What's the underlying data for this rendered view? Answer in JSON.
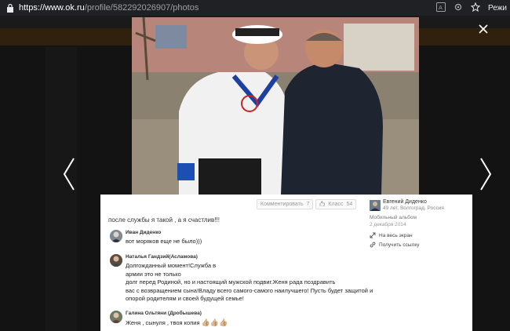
{
  "browser": {
    "url_domain": "https://www.ok.ru",
    "url_path": "/profile/582292026907/photos",
    "mode_label": "Режи"
  },
  "viewer": {
    "actions": {
      "comment_label": "Комментировать",
      "comment_count": "7",
      "like_label": "Класс",
      "like_count": "54"
    },
    "caption": "после службы  я такой  , а я счастлив!!!",
    "comments": [
      {
        "author": "Иван Диденко",
        "lines": [
          "вот моряков еще не было)))"
        ]
      },
      {
        "author": "Наталья Гандзий(Асламова)",
        "lines": [
          "Долгожданный момент!Служба в",
          "армии это не только",
          "долг перед Родиной, но и настоящий мужской подвиг.Женя рада поздравить",
          "вас с возвращением сына!Владу всего  самого-самого наилучшего! Пусть будет защитой и",
          "опорой родителям и своей будущей семье!"
        ]
      },
      {
        "author": "Галина Ольтяни (Дробышева)",
        "lines": [
          " Женя , сынуля , твоя копия"
        ],
        "emoji": "👍🏼👍🏼👍🏼"
      }
    ],
    "owner": {
      "name": "Евгений Диденко",
      "meta": "49 лет, Волгоград, Россия",
      "album": "Мобильный альбом",
      "date": "2 декабря 2014"
    },
    "links": {
      "fullscreen": "На весь экран",
      "get_link": "Получить ссылку"
    }
  },
  "colors": {
    "accent": "#ee8208",
    "overlay": "#000000"
  }
}
